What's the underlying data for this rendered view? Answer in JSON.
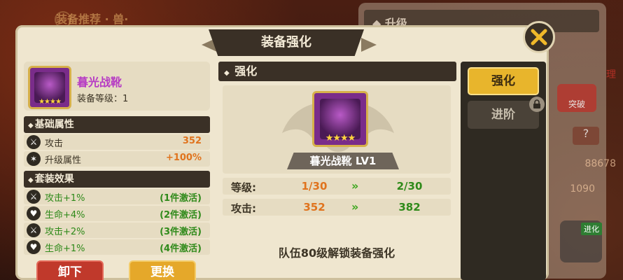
{
  "background": {
    "top_title": "装备推荐 · 兽·",
    "right_header": "升级",
    "right_red_text": "理",
    "breakthrough_label": "突破",
    "question_mark": "?",
    "value_1": "88678",
    "value_2": "1090",
    "advance_badge": "进化"
  },
  "dialog": {
    "title": "装备强化"
  },
  "item": {
    "name": "暮光战靴",
    "stars": "★★★★",
    "level_label": "装备等级：1"
  },
  "basic_attributes": {
    "header": "基础属性",
    "rows": [
      {
        "label": "攻击",
        "value": "352",
        "icon": "sword-icon",
        "glyph": "⚔"
      },
      {
        "label": "升级属性",
        "value": "+100%",
        "icon": "wings-icon",
        "glyph": "✶"
      }
    ]
  },
  "set_effects": {
    "header": "套装效果",
    "rows": [
      {
        "label": "攻击+1%",
        "value": "(1件激活)",
        "icon": "sword-icon",
        "glyph": "⚔"
      },
      {
        "label": "生命+4%",
        "value": "(2件激活)",
        "icon": "heart-icon",
        "glyph": "♥"
      },
      {
        "label": "攻击+2%",
        "value": "(3件激活)",
        "icon": "sword-icon",
        "glyph": "⚔"
      },
      {
        "label": "生命+1%",
        "value": "(4件激活)",
        "icon": "heart-icon",
        "glyph": "♥"
      }
    ]
  },
  "buttons": {
    "unequip": "卸下",
    "change": "更换"
  },
  "strengthen": {
    "header": "强化",
    "item_plate": "暮光战靴  LV1",
    "stars": "★★★★",
    "stats": [
      {
        "label": "等级:",
        "old": "1/30",
        "new": "2/30"
      },
      {
        "label": "攻击:",
        "old": "352",
        "new": "382"
      }
    ],
    "arrow": "»",
    "unlock_message": "队伍80级解锁装备强化"
  },
  "tabs": {
    "strengthen": "强化",
    "advance": "进阶"
  }
}
